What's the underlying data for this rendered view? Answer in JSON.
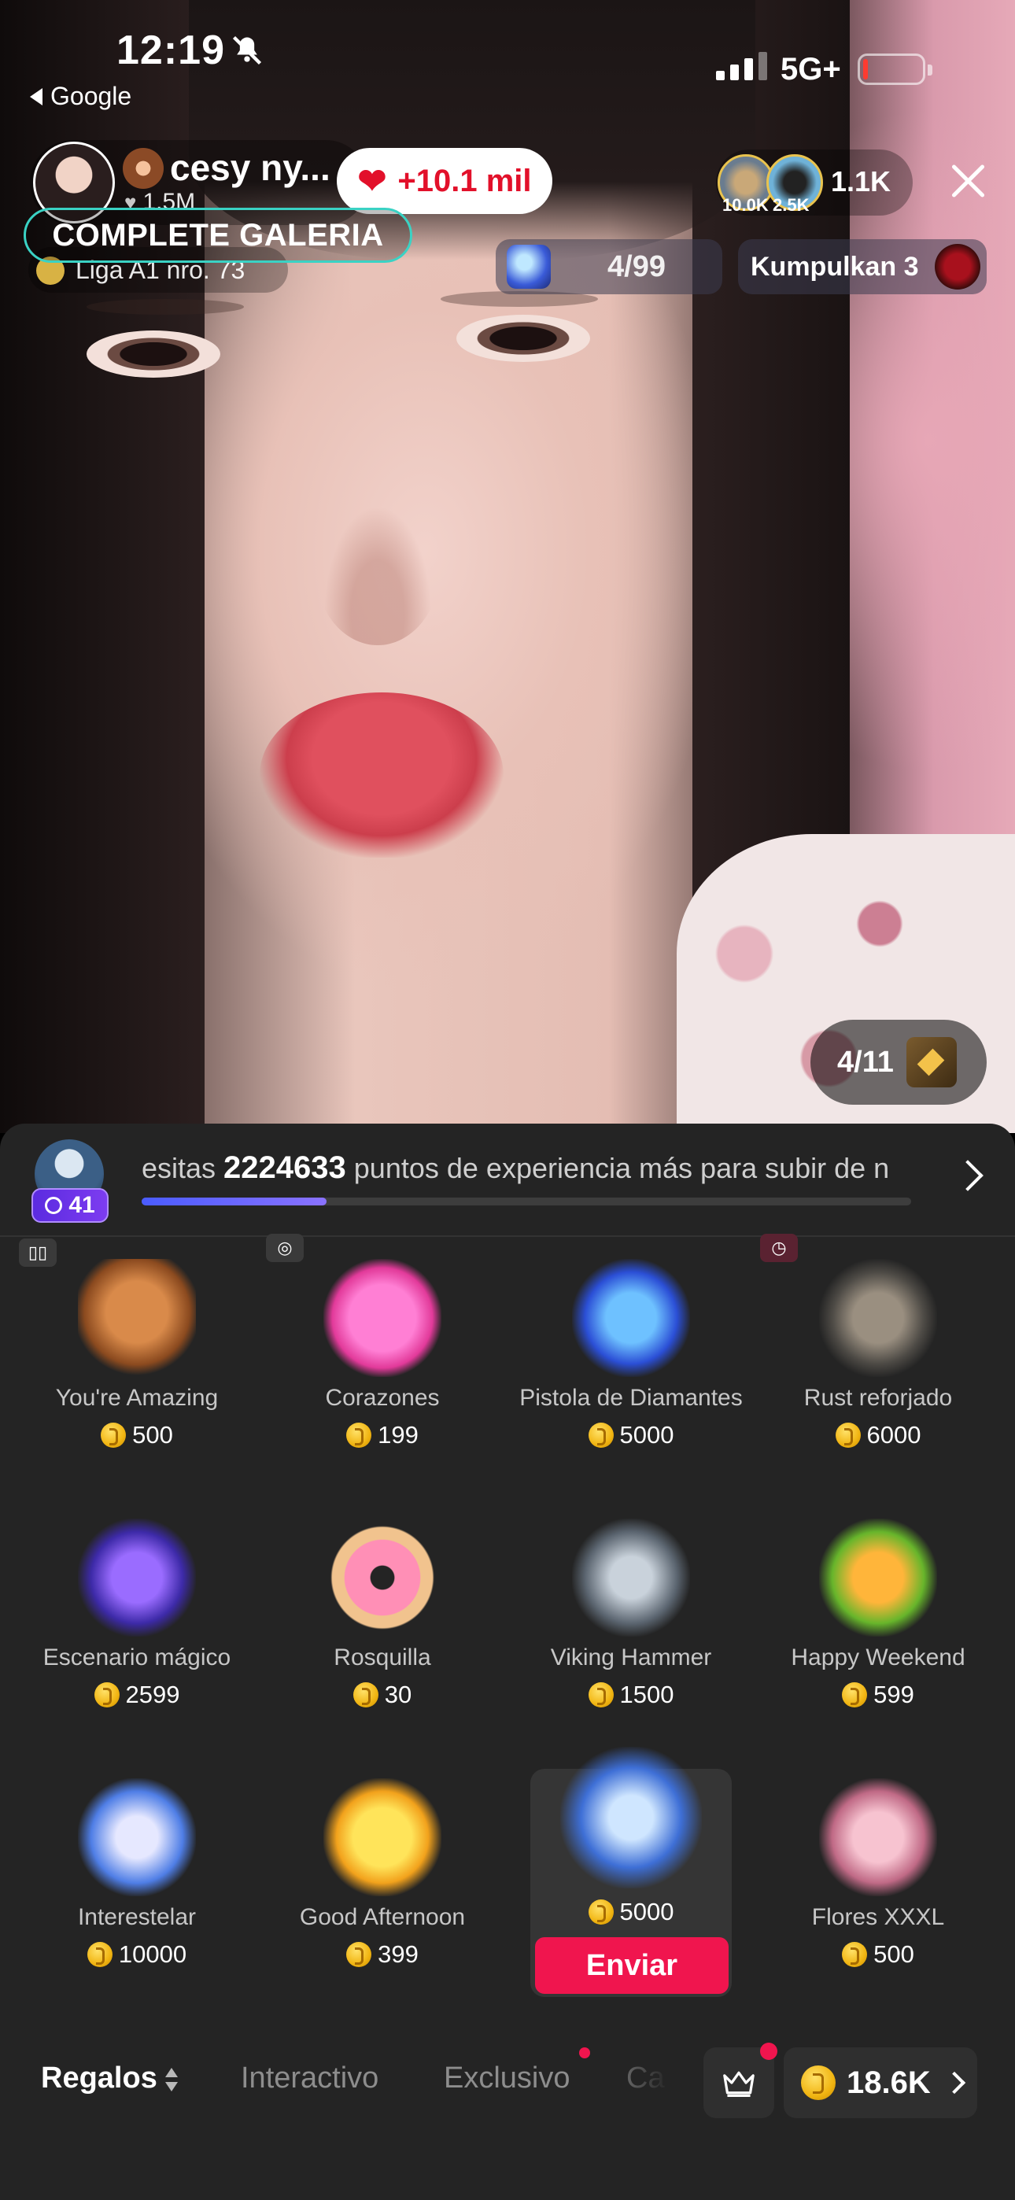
{
  "status_bar": {
    "time": "12:19",
    "back_label": "Google",
    "network": "5G+"
  },
  "live": {
    "host_name": "cesy ny...",
    "host_likes": "1.5M",
    "like_burst": "+10.1 mil",
    "galeria_label": "COMPLETE GALERIA",
    "liga_label": "Liga A1 nro. 73",
    "viewer_badges": [
      "10.0K",
      "2.5K"
    ],
    "viewer_total": "1.1K",
    "goal_progress": "4/99",
    "kumpul_label": "Kumpulkan 3",
    "box_counter": "4/11"
  },
  "panel": {
    "level": "41",
    "xp_message_pre": "esitas ",
    "xp_points": "2224633",
    "xp_message_post": " puntos de experiencia más para subir de n",
    "xp_progress_fraction": 0.24
  },
  "gifts": [
    {
      "name": "You're Amazing",
      "price": "500"
    },
    {
      "name": "Corazones",
      "price": "199"
    },
    {
      "name": "Pistola de Diamantes",
      "price": "5000"
    },
    {
      "name": "Rust reforjado",
      "price": "6000"
    },
    {
      "name": "Escenario mágico",
      "price": "2599"
    },
    {
      "name": "Rosquilla",
      "price": "30"
    },
    {
      "name": "Viking Hammer",
      "price": "1500"
    },
    {
      "name": "Happy Weekend",
      "price": "599"
    },
    {
      "name": "Interestelar",
      "price": "10000"
    },
    {
      "name": "Good Afternoon",
      "price": "399"
    },
    {
      "name": "",
      "price": "5000"
    },
    {
      "name": "Flores XXXL",
      "price": "500"
    }
  ],
  "send_label": "Enviar",
  "tabs": {
    "regalos": "Regalos",
    "interactivo": "Interactivo",
    "exclusivo": "Exclusivo",
    "partial": "Ca"
  },
  "balance": "18.6K",
  "colors": {
    "accent": "#f0154e",
    "panel_bg": "#242424",
    "coin": "#f1b512",
    "level_badge": "#5b2be0"
  }
}
